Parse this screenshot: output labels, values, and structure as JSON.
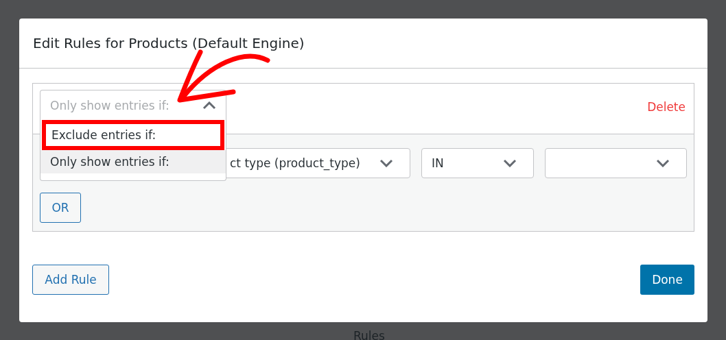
{
  "modal": {
    "title": "Edit Rules for Products (Default Engine)"
  },
  "rule": {
    "mode_select": {
      "value": "Only show entries if:",
      "expanded": true,
      "options": [
        {
          "label": "Exclude entries if:",
          "selected": false,
          "highlighted": true
        },
        {
          "label": "Only show entries if:",
          "selected": true,
          "highlighted": false
        }
      ]
    },
    "delete_label": "Delete",
    "condition_selects": [
      {
        "kind": "text",
        "text": "ct type (product_type)"
      },
      {
        "kind": "text",
        "text": "IN"
      },
      {
        "kind": "empty"
      }
    ],
    "or_button": "OR"
  },
  "buttons": {
    "add_rule": "Add Rule",
    "done": "Done"
  },
  "background": {
    "heading": "Rules"
  }
}
